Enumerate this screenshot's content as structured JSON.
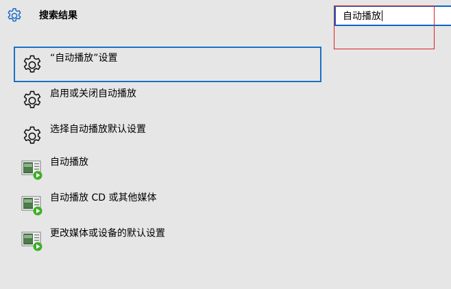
{
  "header": {
    "title": "搜索结果",
    "icon": "gear-icon"
  },
  "search": {
    "value": "自动播放"
  },
  "results": [
    {
      "label": "“自动播放”设置",
      "icon": "gear-icon",
      "selected": true
    },
    {
      "label": "启用或关闭自动播放",
      "icon": "gear-icon",
      "selected": false
    },
    {
      "label": "选择自动播放默认设置",
      "icon": "gear-icon",
      "selected": false
    },
    {
      "label": "自动播放",
      "icon": "autoplay-app-icon",
      "selected": false
    },
    {
      "label": "自动播放 CD 或其他媒体",
      "icon": "autoplay-app-icon",
      "selected": false
    },
    {
      "label": "更改媒体或设备的默认设置",
      "icon": "autoplay-app-icon",
      "selected": false
    }
  ],
  "colors": {
    "background": "#e6e6e6",
    "accent": "#0a63c9",
    "highlight": "#e01e1e",
    "play": "#3fae29"
  }
}
